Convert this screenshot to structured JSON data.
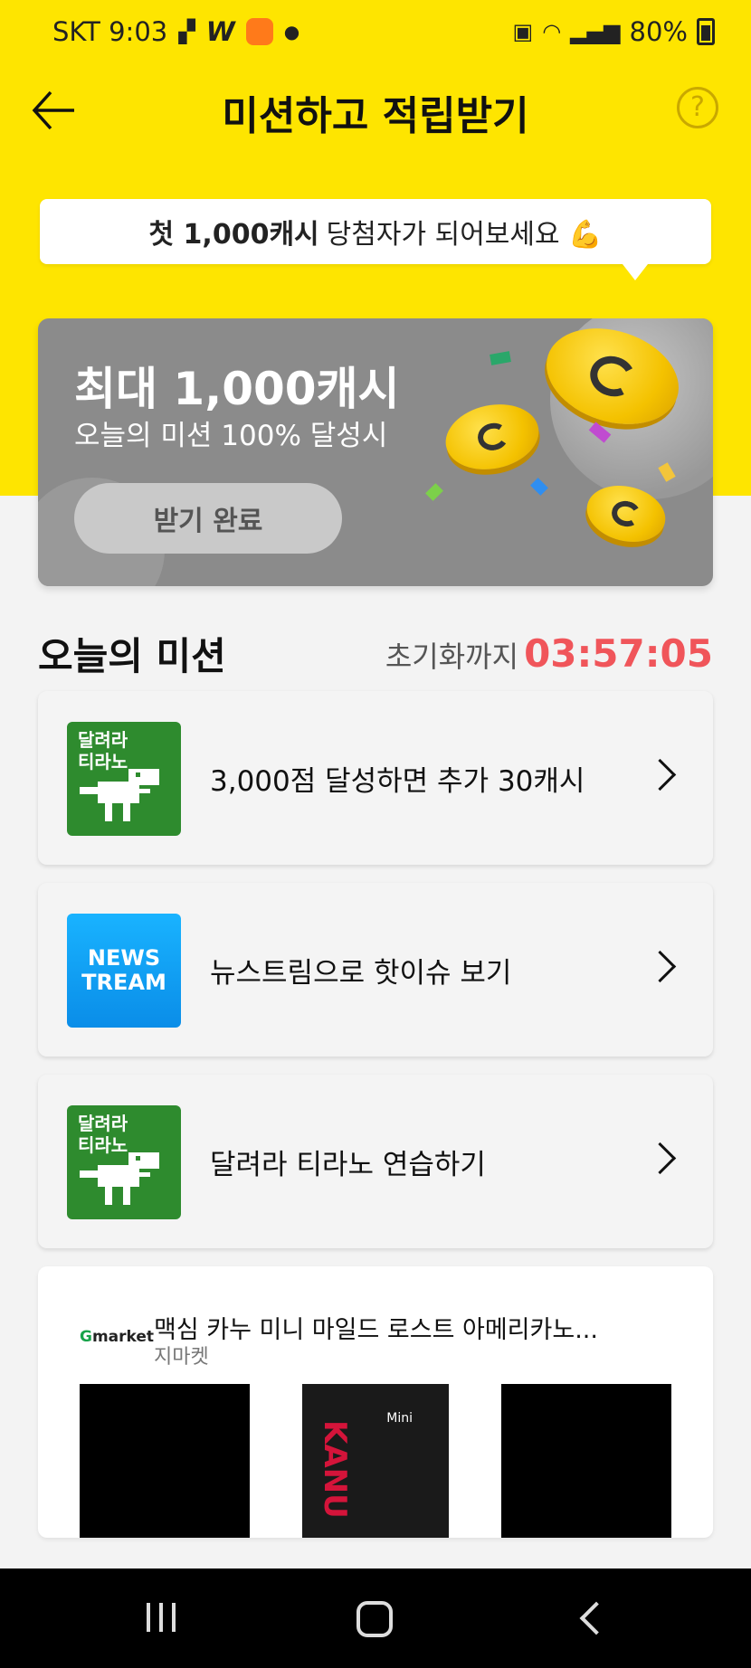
{
  "status_bar": {
    "carrier_time": "SKT 9:03",
    "w_badge": "W",
    "battery": "80%"
  },
  "header": {
    "title": "미션하고 적립받기",
    "help": "?"
  },
  "tooltip": {
    "bold": "첫 1,000캐시",
    "text": "당첨자가 되어보세요 💪"
  },
  "promo": {
    "title": "최대 1,000캐시",
    "subtitle": "오늘의 미션 100% 달성시",
    "button": "받기 완료"
  },
  "missions_section": {
    "title": "오늘의 미션",
    "timer_label": "초기화까지",
    "timer_value": "03:57:05"
  },
  "missions": [
    {
      "thumb_text_1": "달려라",
      "thumb_text_2": "티라노",
      "label": "3,000점 달성하면 추가 30캐시"
    },
    {
      "thumb_text_1": "NEWS",
      "thumb_text_2": "TREAM",
      "label": "뉴스트림으로 핫이슈 보기"
    },
    {
      "thumb_text_1": "달려라",
      "thumb_text_2": "티라노",
      "label": "달려라 티라노 연습하기"
    }
  ],
  "ad": {
    "logo_g": "G",
    "logo_rest": "market",
    "title": "맥심 카누 미니 마일드 로스트 아메리카노...",
    "source": "지마켓",
    "product_mini": "Mini",
    "product_brand": "KANU"
  },
  "colors": {
    "header_bg": "#fee500",
    "timer": "#f0555a",
    "dino_green": "#2e8b2e"
  }
}
